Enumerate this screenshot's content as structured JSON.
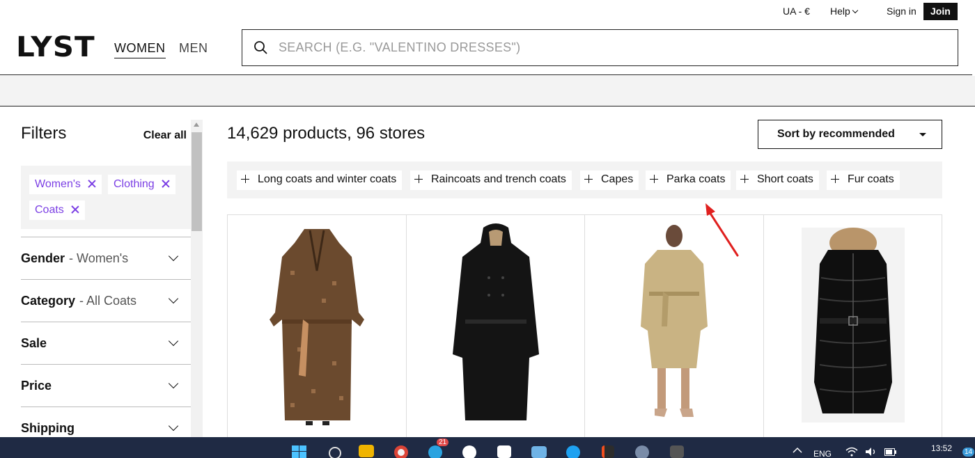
{
  "utility": {
    "region": "UA - €",
    "help": "Help",
    "sign_in": "Sign in",
    "join": "Join"
  },
  "header": {
    "logo": "LYST",
    "nav_women": "WOMEN",
    "nav_men": "MEN",
    "search_placeholder": "SEARCH (E.G. \"VALENTINO DRESSES\")"
  },
  "sidebar": {
    "title": "Filters",
    "clear_all": "Clear all",
    "active_filters": [
      "Women's",
      "Clothing",
      "Coats"
    ],
    "facets": [
      {
        "label": "Gender",
        "value": "- Women's"
      },
      {
        "label": "Category",
        "value": "- All Coats"
      },
      {
        "label": "Sale",
        "value": ""
      },
      {
        "label": "Price",
        "value": ""
      },
      {
        "label": "Shipping",
        "value": ""
      }
    ]
  },
  "main": {
    "results": "14,629 products, 96 stores",
    "sort_label": "Sort by recommended",
    "categories": [
      "Long coats and winter coats",
      "Raincoats and trench coats",
      "Capes",
      "Parka coats",
      "Short coats",
      "Fur coats"
    ],
    "products": [
      {
        "image": "monogram-trench-coat-brown"
      },
      {
        "image": "hooded-trench-coat-black"
      },
      {
        "image": "belted-trench-coat-beige"
      },
      {
        "image": "puffer-coat-fur-hood-black"
      }
    ]
  },
  "taskbar": {
    "language": "ENG",
    "time": "13:52",
    "telegram_badge": "21",
    "notification_count": "14"
  },
  "colors": {
    "accent_purple": "#7b3fe4",
    "annotation_red": "#e0201f",
    "taskbar": "#1f2a44"
  }
}
